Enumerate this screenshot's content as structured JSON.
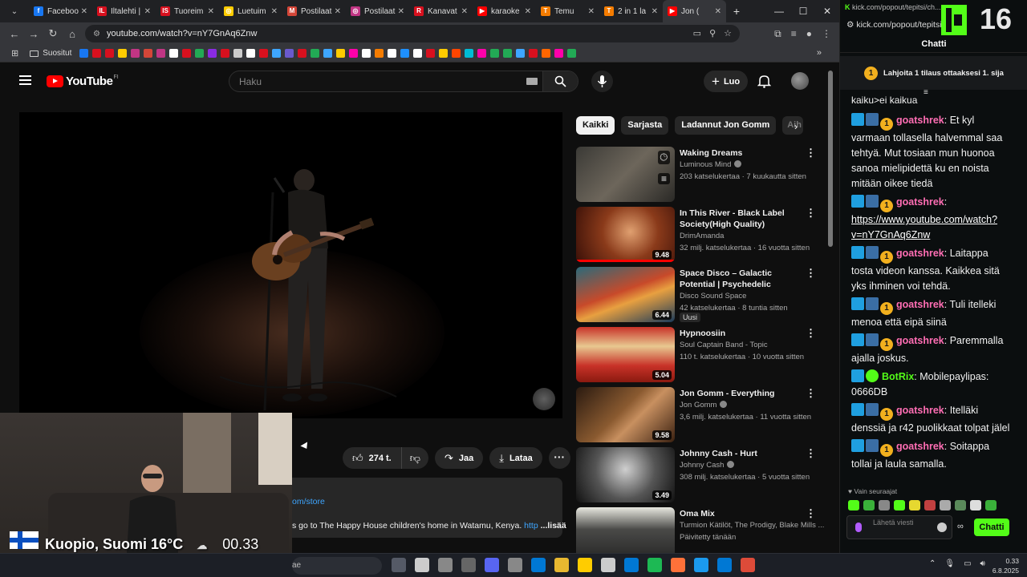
{
  "browser": {
    "tabs": [
      {
        "label": "Faceboo",
        "color": "#1877f2",
        "glyph": "f"
      },
      {
        "label": "Iltalehti |",
        "color": "#d8101e",
        "glyph": "IL"
      },
      {
        "label": "Tuoreim",
        "color": "#d8101e",
        "glyph": "IS"
      },
      {
        "label": "Luetuim",
        "color": "#ffcc00",
        "glyph": "◎"
      },
      {
        "label": "Postilaat",
        "color": "#d44638",
        "glyph": "M"
      },
      {
        "label": "Postilaat",
        "color": "#c13584",
        "glyph": "◎"
      },
      {
        "label": "Kanavat",
        "color": "#d8101e",
        "glyph": "R"
      },
      {
        "label": "karaoke",
        "color": "#ff0000",
        "glyph": "▶"
      },
      {
        "label": "Temu",
        "color": "#f57c00",
        "glyph": "T"
      },
      {
        "label": "2 in 1 la",
        "color": "#f57c00",
        "glyph": "T"
      },
      {
        "label": "Jon (",
        "color": "#ff0000",
        "glyph": "▶"
      }
    ],
    "new_tab": "+",
    "url": "youtube.com/watch?v=nY7GnAq6Znw",
    "bookmarks_folder": "Suositut",
    "bookmark_colors": [
      "#1877f2",
      "#d8101e",
      "#d8101e",
      "#ffcc00",
      "#c13584",
      "#d44638",
      "#c13584",
      "#ffffff",
      "#d8101e",
      "#22aa55",
      "#8a2be2",
      "#d8101e",
      "#cccccc",
      "#ffffff",
      "#d8101e",
      "#3ea6ff",
      "#6a5acd",
      "#d8101e",
      "#22aa55",
      "#3ea6ff",
      "#ffcc00",
      "#ff00aa",
      "#ffffff",
      "#f57c00",
      "#ffffff",
      "#1e90ff",
      "#ffffff",
      "#d8101e",
      "#ffcc00",
      "#ff4500",
      "#00bcd4",
      "#ff00aa",
      "#22aa55",
      "#22aa55",
      "#3ea6ff",
      "#d8101e",
      "#ff6600",
      "#ff00aa",
      "#22aa55"
    ]
  },
  "youtube": {
    "logo_text": "YouTube",
    "logo_country": "FI",
    "search_placeholder": "Haku",
    "create_label": "Luo",
    "like_count": "274 t.",
    "share_label": "Jaa",
    "download_label": "Lataa",
    "desc_link": "om/store",
    "desc_text": "s go to The Happy House children's home in Watamu, Kenya.",
    "desc_link2": "http",
    "desc_more": "...lisää",
    "chips": [
      "Kaikki",
      "Sarjasta",
      "Ladannut Jon Gomm",
      "Aih"
    ],
    "recommendations": [
      {
        "title": "Waking Dreams",
        "channel": "Luminous Mind",
        "verified": true,
        "meta": "203 katselukertaa · 7 kuukautta sitten",
        "duration": "",
        "thumb": "linear-gradient(135deg,#3b3a36,#6d665b 50%,#2a2926)"
      },
      {
        "title": "In This River - Black Label Society(High Quality)",
        "channel": "DrimAmanda",
        "verified": false,
        "meta": "32 milj. katselukertaa · 16 vuotta sitten",
        "duration": "9.48",
        "thumb": "radial-gradient(circle at 55% 45%,#e0a070,#8a3a1a 45%,#3a1008)"
      },
      {
        "title": "Space Disco – Galactic Potential | Psychedelic Synths,...",
        "channel": "Disco Sound Space",
        "verified": false,
        "meta": "42 katselukertaa · 8 tuntia sitten",
        "duration": "6.44",
        "badge": "Uusi",
        "thumb": "linear-gradient(160deg,#2a6a7a,#c84a2a 45%,#e8a040 60%,#1a3a5a)"
      },
      {
        "title": "Hypnoosiin",
        "channel": "Soul Captain Band - Topic",
        "verified": false,
        "meta": "110 t. katselukertaa · 10 vuotta sitten",
        "duration": "5.04",
        "thumb": "linear-gradient(180deg,#c83228,#e8c890 35%,#c83228 70%,#8a1a10)"
      },
      {
        "title": "Jon Gomm - Everything",
        "channel": "Jon Gomm",
        "verified": true,
        "meta": "3,6 milj. katselukertaa · 11 vuotta sitten",
        "duration": "9.58",
        "thumb": "linear-gradient(135deg,#2a1a10,#8a5a30 45%,#c89060 60%,#3a2010)"
      },
      {
        "title": "Johnny Cash - Hurt",
        "channel": "Johnny Cash",
        "verified": true,
        "meta": "308 milj. katselukertaa · 5 vuotta sitten",
        "duration": "3.49",
        "thumb": "radial-gradient(circle at 50% 40%,#cfcfcf,#555 50%,#111)"
      },
      {
        "title": "Oma Mix",
        "channel": "Turmion Kätilöt, The Prodigy, Blake Mills ...",
        "verified": false,
        "meta": "Päivitetty tänään",
        "duration": "",
        "thumb": "linear-gradient(180deg,#e8e8e0,#4a4a48 40%,#222)"
      }
    ]
  },
  "webcam": {
    "location": "Kuopio, Suomi",
    "temperature": "16°C",
    "time": "00.33"
  },
  "kick": {
    "tab_url": "kick.com/popout/tepitsi/ch...",
    "url": "kick.com/popout/tepitsi/",
    "viewer_count": "16",
    "chat_title": "Chatti",
    "promo": "Lahjoita 1 tilaus ottaaksesi 1. sija",
    "partial_line": "kaiku>ei kaikua",
    "messages": [
      {
        "user": "goatshrek",
        "bot": false,
        "text": " Et kyl varmaan tollasella halvemmal saa tehtyä. Mut tosiaan mun huonoa sanoa mielipidettä ku en noista mitään oikee tiedä"
      },
      {
        "user": "goatshrek",
        "bot": false,
        "text": " ",
        "url": "https://www.youtube.com/watch?v=nY7GnAq6Znw"
      },
      {
        "user": "goatshrek",
        "bot": false,
        "text": " Laitappa tosta videon kanssa. Kaikkea sitä yks ihminen voi tehdä."
      },
      {
        "user": "goatshrek",
        "bot": false,
        "text": " Tuli itelleki menoa että eipä siinä"
      },
      {
        "user": "goatshrek",
        "bot": false,
        "text": " Paremmalla ajalla joskus."
      },
      {
        "user": "BotRix",
        "bot": true,
        "text": " Mobilepaylipas: 0666DB"
      },
      {
        "user": "goatshrek",
        "bot": false,
        "text": " Itelläki denssiä ja r42 puolikkaat tolpat jälel"
      },
      {
        "user": "goatshrek",
        "bot": false,
        "text": " Soitappa tollai ja laula samalla."
      }
    ],
    "followers_only": "Vain seuraajat",
    "input_placeholder": "Lähetä viesti",
    "send_label": "Chatti"
  },
  "taskbar": {
    "search_text": "ae",
    "time": "0.33",
    "date": "6.8.2025",
    "app_colors": [
      "#555a66",
      "#cccccc",
      "#888888",
      "#666666",
      "#5865f2",
      "#888888",
      "#0078d4",
      "#e8b830",
      "#ffcc00",
      "#cccccc",
      "#0078d4",
      "#1db954",
      "#ff7139",
      "#1b9aee",
      "#0078d4",
      "#dd4b39"
    ]
  }
}
